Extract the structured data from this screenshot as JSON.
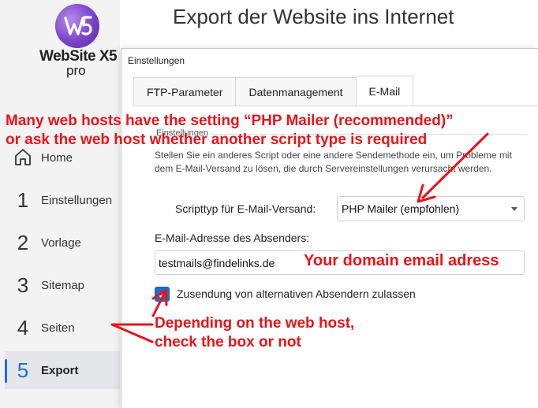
{
  "app": {
    "logo_text": "WebSite X5",
    "logo_sub": "pro",
    "page_title": "Export der Website ins Internet"
  },
  "sidebar": {
    "items": [
      {
        "num": "",
        "label": "Home",
        "icon": "home-icon"
      },
      {
        "num": "1",
        "label": "Einstellungen"
      },
      {
        "num": "2",
        "label": "Vorlage"
      },
      {
        "num": "3",
        "label": "Sitemap"
      },
      {
        "num": "4",
        "label": "Seiten"
      },
      {
        "num": "5",
        "label": "Export",
        "active": true
      }
    ]
  },
  "dialog": {
    "title": "Einstellungen",
    "tabs": [
      "FTP-Parameter",
      "Datenmanagement",
      "E-Mail"
    ],
    "active_tab": "E-Mail",
    "group_label": "Einstellungen",
    "description": "Stellen Sie ein anderes Script oder eine andere Sendemethode ein, um Probleme mit dem E-Mail-Versand zu lösen, die  durch Servereinstellungen verursacht werden.",
    "script_label": "Scripttyp für E-Mail-Versand:",
    "script_value": "PHP Mailer (empfohlen)",
    "sender_label": "E-Mail-Adresse des Absenders:",
    "sender_value": "testmails@findelinks.de",
    "checkbox_label": "Zusendung von alternativen Absendern zulassen",
    "checkbox_checked": true
  },
  "annotations": {
    "top_line1": "Many web hosts have the setting “PHP Mailer (recommended)”",
    "top_line2": "or ask the web host whether another script type is required",
    "domain_email": "Your domain email adress",
    "depend_line1": "Depending on the web host,",
    "depend_line2": "check the box or not",
    "color": "#e8141a"
  },
  "colors": {
    "accent": "#1f6fd1",
    "sidebar_bg": "#f3f3f3",
    "checkbox": "#1e6fc6"
  }
}
